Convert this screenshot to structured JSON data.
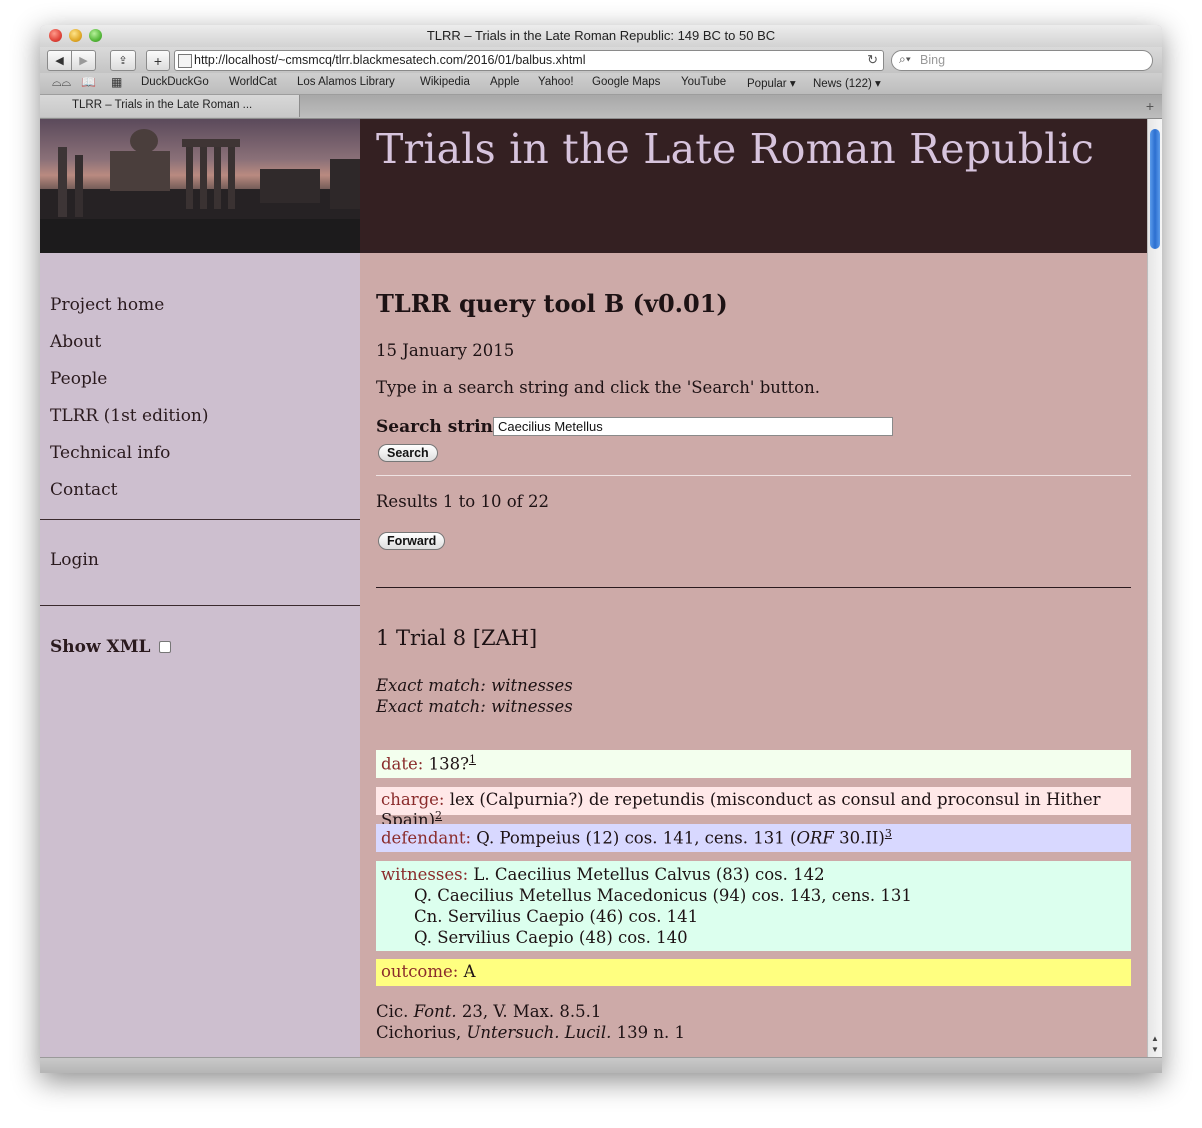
{
  "window": {
    "title": "TLRR – Trials in the Late Roman Republic: 149 BC to 50 BC"
  },
  "toolbar": {
    "url": "http://localhost/~cmsmcq/tlrr.blackmesatech.com/2016/01/balbus.xhtml",
    "search_placeholder": "Bing"
  },
  "bookmarks": [
    "DuckDuckGo",
    "WorldCat",
    "Los Alamos Library",
    "Wikipedia",
    "Apple",
    "Yahoo!",
    "Google Maps",
    "YouTube",
    "Popular ▾",
    "News (122) ▾"
  ],
  "tab": {
    "label": "TLRR – Trials in the Late Roman ..."
  },
  "site": {
    "title": "Trials in the Late Roman Republic"
  },
  "sidebar": {
    "items": [
      "Project home",
      "About",
      "People",
      "TLRR (1st edition)",
      "Technical info",
      "Contact"
    ],
    "login": "Login",
    "show_xml": "Show XML"
  },
  "main": {
    "heading": "TLRR query tool B (v0.01)",
    "date": "15 January 2015",
    "instruction": "Type in a search string and click the 'Search' button.",
    "search_label": "Search string:",
    "search_value": "Caecilius Metellus",
    "search_button": "Search",
    "results": "Results 1 to 10 of 22",
    "forward_button": "Forward",
    "trial_heading": "1 Trial 8 [ZAH]",
    "match_1": "Exact match: witnesses",
    "match_2": "Exact match: witnesses",
    "fields": {
      "date_key": "date:",
      "date_val": "138?",
      "date_note": "1",
      "charge_key": "charge:",
      "charge_val": "lex (Calpurnia?) de repetundis (misconduct as consul and proconsul in Hither Spain)",
      "charge_note": "2",
      "defendant_key": "defendant:",
      "defendant_val_a": "Q. Pompeius (12) cos. 141, cens. 131 (",
      "defendant_orf": "ORF",
      "defendant_val_b": " 30.II)",
      "defendant_note": "3",
      "witnesses_key": "witnesses:",
      "witnesses": [
        "L. Caecilius Metellus Calvus (83) cos. 142",
        "Q. Caecilius Metellus Macedonicus (94) cos. 143, cens. 131",
        "Cn. Servilius Caepio (46) cos. 141",
        "Q. Servilius Caepio (48) cos. 140"
      ],
      "outcome_key": "outcome:",
      "outcome_val": "A"
    },
    "source_1a": "Cic. ",
    "source_1b": "Font.",
    "source_1c": " 23, V. Max. 8.5.1",
    "source_2a": "Cichorius, ",
    "source_2b": "Untersuch. Lucil.",
    "source_2c": " 139 n. 1"
  },
  "colors": {
    "header_band": "#342022",
    "site_title": "#d7c4dd",
    "sidebar": "#cdbfcf",
    "main_bg": "#cdaaa8",
    "field_key": "#8a2b2b",
    "date_box": "#f3ffee",
    "charge_box": "#ffe8e8",
    "defendant_box": "#d8d8ff",
    "witness_box": "#dcffee",
    "outcome_box": "#ffff80"
  }
}
